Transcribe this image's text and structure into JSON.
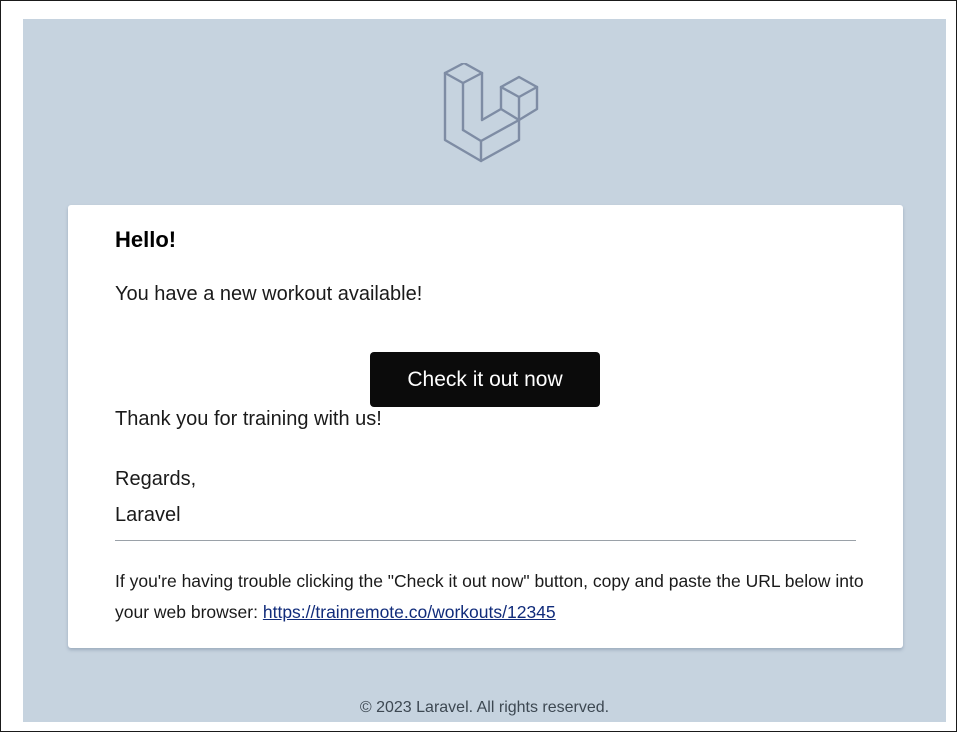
{
  "colors": {
    "background": "#c6d3df",
    "card": "#ffffff",
    "button": "#0b0b0b",
    "button_text": "#ffffff",
    "logo_stroke": "#7e8ca4",
    "link": "#102b7a"
  },
  "header": {
    "logo_icon": "laravel-logo-icon"
  },
  "content": {
    "greeting": "Hello!",
    "intro_line": "You have a new workout available!",
    "action_label": "Check it out now",
    "outro_line": "Thank you for training with us!",
    "salutation": "Regards,",
    "signature": "Laravel",
    "subcopy_text": "If you're having trouble clicking the \"Check it out now\" button, copy and paste the URL below into your web browser:",
    "action_url": "https://trainremote.co/workouts/12345"
  },
  "footer": {
    "copyright": "© 2023 Laravel. All rights reserved."
  }
}
